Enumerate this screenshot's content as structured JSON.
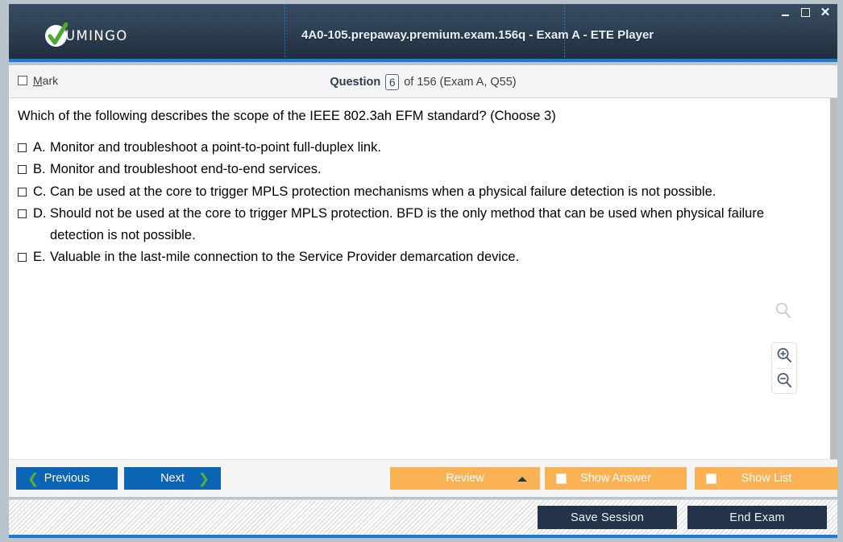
{
  "window": {
    "title": "4A0-105.prepaway.premium.exam.156q - Exam A - ETE Player",
    "brand_name": "UMINGO",
    "controls": {
      "minimize": "–",
      "maximize": "□",
      "close": "✕"
    }
  },
  "question_header": {
    "mark_label_accel": "M",
    "mark_label_rest": "ark",
    "question_word": "Question",
    "question_number": "6",
    "of_text": "of 156 (Exam A, Q55)"
  },
  "question": {
    "text": "Which of the following describes the scope of the IEEE 802.3ah EFM standard? (Choose 3)",
    "options": [
      {
        "letter": "A.",
        "text": "Monitor and troubleshoot a point-to-point full-duplex link.",
        "checked": false
      },
      {
        "letter": "B.",
        "text": "Monitor and troubleshoot end-to-end services.",
        "checked": false
      },
      {
        "letter": "C.",
        "text": "Can be used at the core to trigger MPLS protection mechanisms when a physical failure detection is not possible.",
        "checked": false
      },
      {
        "letter": "D.",
        "text": "Should not be used at the core to trigger MPLS protection. BFD is the only method that can be used when physical failure detection is not possible.",
        "checked": false
      },
      {
        "letter": "E.",
        "text": "Valuable in the last-mile connection to the Service Provider demarcation device.",
        "checked": false
      }
    ]
  },
  "zoom_tools": {
    "magnifier_icon": "magnifier-icon",
    "zoom_in_icon": "zoom-in-icon",
    "zoom_out_icon": "zoom-out-icon"
  },
  "navbar": {
    "previous_label": "Previous",
    "previous_icon": "chevron-left-icon",
    "next_label": "Next",
    "next_icon": "chevron-right-icon",
    "review_label": "Review",
    "review_caret_icon": "caret-up-icon",
    "show_answer_label": "Show Answer",
    "show_list_label": "Show List"
  },
  "statusbar": {
    "save_session_label": "Save Session",
    "end_exam_label": "End Exam"
  },
  "colors": {
    "titlebar_dark": "#1d2b3a",
    "titlebar_light": "#34495f",
    "accent_blue": "#1a7ad4",
    "nav_button_blue": "#0c64b4",
    "chevron_green": "#5ab02e",
    "orange": "#fbb254",
    "status_navy": "#22344a",
    "frame_gray": "#b9c4cc"
  }
}
